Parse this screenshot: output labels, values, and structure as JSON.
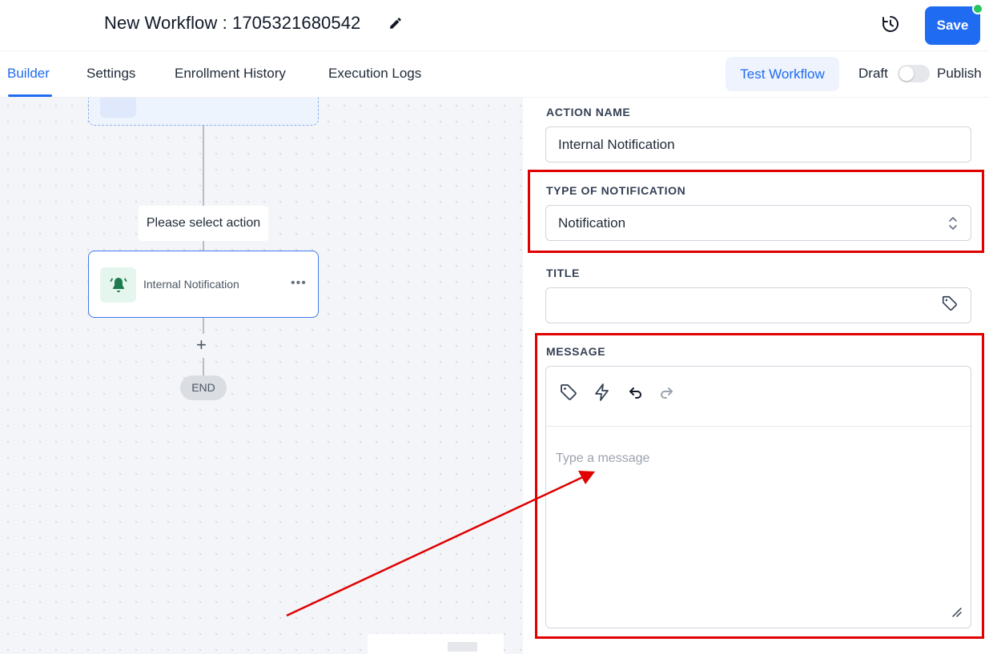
{
  "header": {
    "title": "New Workflow : 1705321680542",
    "save_label": "Save"
  },
  "tabs": [
    {
      "label": "Builder",
      "active": true
    },
    {
      "label": "Settings",
      "active": false
    },
    {
      "label": "Enrollment History",
      "active": false
    },
    {
      "label": "Execution Logs",
      "active": false
    }
  ],
  "actions": {
    "test_label": "Test Workflow",
    "draft_label": "Draft",
    "publish_label": "Publish",
    "publish_on": false
  },
  "canvas": {
    "select_action_label": "Please select action",
    "action_node_label": "Internal Notification",
    "end_label": "END"
  },
  "panel": {
    "action_name_label": "ACTION NAME",
    "action_name_value": "Internal Notification",
    "notification_type_label": "TYPE OF NOTIFICATION",
    "notification_type_value": "Notification",
    "title_label": "TITLE",
    "title_value": "",
    "message_label": "MESSAGE",
    "message_placeholder": "Type a message"
  },
  "colors": {
    "accent": "#1f6bf2",
    "status_dot": "#22c55e",
    "highlight": "#e00000",
    "bell": "#1e7a4f"
  },
  "icons": [
    "edit-icon",
    "history-icon",
    "trigger-icon",
    "bell-icon",
    "more-icon",
    "plus-icon",
    "chevron-updown-icon",
    "tag-icon",
    "lightning-icon",
    "undo-icon",
    "redo-icon",
    "resize-icon"
  ]
}
